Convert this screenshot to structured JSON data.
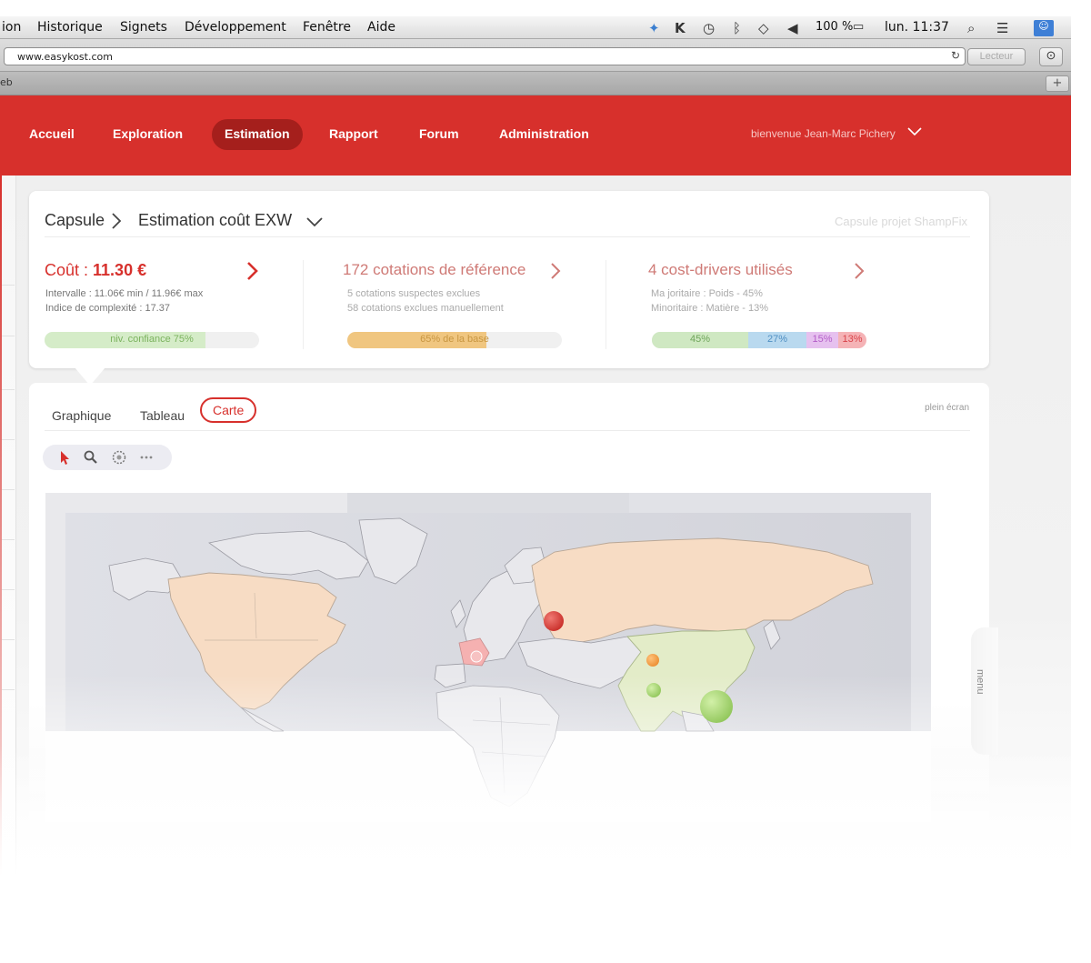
{
  "menubar": {
    "items": [
      "ion",
      "Historique",
      "Signets",
      "Développement",
      "Fenêtre",
      "Aide"
    ],
    "battery": "100 %",
    "clock": "lun. 11:37"
  },
  "browser": {
    "url": "www.easykost.com",
    "reader_label": "Lecteur",
    "tab_label": "eb"
  },
  "nav": {
    "links": [
      "Accueil",
      "Exploration",
      "Estimation",
      "Rapport",
      "Forum",
      "Administration"
    ],
    "active": "Estimation",
    "welcome": "bienvenue Jean-Marc Pichery"
  },
  "summary": {
    "breadcrumb": [
      "Capsule",
      "Estimation coût EXW"
    ],
    "project": "Capsule projet ShampFix",
    "cost": {
      "label": "Coût : ",
      "value": "11.30 €",
      "interval": "Intervalle : 11.06€ min / 11.96€ max",
      "complexity": "Indice de complexité : 17.37",
      "confidence_label": "niv. confiance 75%",
      "confidence": 0.75
    },
    "quotes": {
      "title": "172 cotations de référence",
      "suspect": "5 cotations suspectes exclues",
      "manual": "58 cotations exclues manuellement",
      "base_label": "65% de la base",
      "base": 0.65
    },
    "drivers": {
      "title": "4 cost-drivers utilisés",
      "major": "Ma joritaire : Poids - 45%",
      "minor": "Minoritaire : Matière - 13%",
      "segments": [
        {
          "label": "45%",
          "share": 0.45,
          "color": "#cfe8c2",
          "text_color": "#6fa55a"
        },
        {
          "label": "27%",
          "share": 0.27,
          "color": "#b9d9ef",
          "text_color": "#4f8fc2"
        },
        {
          "label": "15%",
          "share": 0.15,
          "color": "#e6c1ef",
          "text_color": "#b45dc8"
        },
        {
          "label": "13%",
          "share": 0.13,
          "color": "#f5b3b6",
          "text_color": "#d9434a"
        }
      ]
    }
  },
  "view": {
    "tabs": [
      "Graphique",
      "Tableau",
      "Carte"
    ],
    "active_tab": "Carte",
    "fullscreen": "plein écran",
    "side_menu": "menu"
  },
  "map": {
    "colors": {
      "north_america": "#f7dcc4",
      "russia": "#f7dcc4",
      "asia_highlight": "#e3ecc8",
      "france": "#f5b1b1",
      "land": "#e9e9ec",
      "bubble_red": "#d73b36",
      "bubble_orange": "#f0a14b",
      "bubble_green": "#a9d57a"
    }
  },
  "colors": {
    "brand_red": "#d7302c",
    "nav_active": "#a51f1c"
  }
}
